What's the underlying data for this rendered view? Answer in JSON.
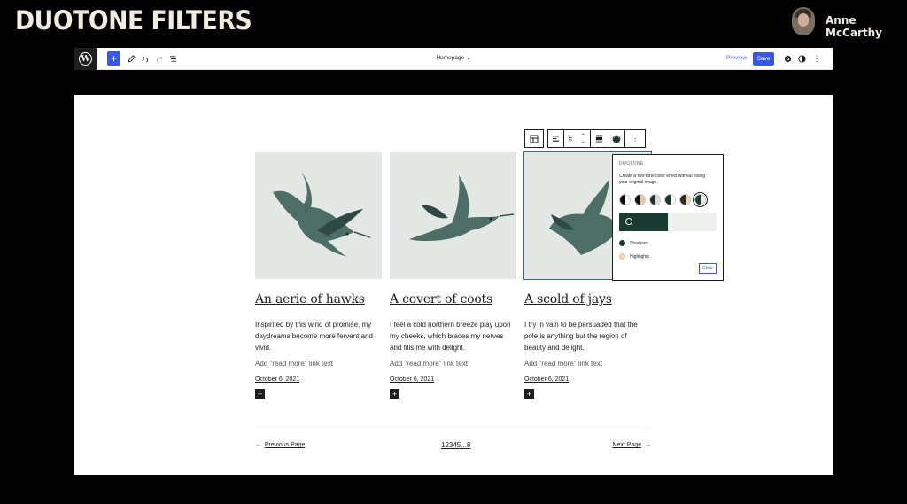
{
  "slide": {
    "title": "DUOTONE FILTERS",
    "presenter_name": "Anne McCarthy"
  },
  "topbar": {
    "add_icon": "+",
    "doc_title": "Homepage",
    "chevron": "⌄",
    "preview_label": "Preview",
    "save_label": "Save"
  },
  "block_toolbar": {
    "more_icon": "⋮"
  },
  "posts": [
    {
      "title": "An aerie of hawks",
      "excerpt": "Inspirited by this wind of promise, my daydreams become more fervent and vivid.",
      "read_more": "Add \"read more\" link text",
      "date": "October 6, 2021"
    },
    {
      "title": "A covert of coots",
      "excerpt": "I feel a cold northern breeze play upon my cheeks, which braces my nerves and fills me with delight.",
      "read_more": "Add \"read more\" link text",
      "date": "October 6, 2021"
    },
    {
      "title": "A scold of jays",
      "excerpt": "I try in vain to be persuaded that the pole is anything but the region of beauty and delight.",
      "read_more": "Add \"read more\" link text",
      "date": "October 6, 2021"
    }
  ],
  "duotone": {
    "title": "DUOTONE",
    "description": "Create a two-tone color effect without losing your original image.",
    "shadows_label": "Shadows",
    "highlights_label": "Highlights",
    "clear_label": "Clear",
    "shadow_color": "#1a3a32",
    "highlight_color": "#f3dcc0"
  },
  "pagination": {
    "previous": "Previous Page",
    "pages": "12345...8",
    "next": "Next Page"
  },
  "colors": {
    "accent": "#3858e9",
    "image_bg": "#e4e8e4",
    "bird": "#4d6e66"
  }
}
